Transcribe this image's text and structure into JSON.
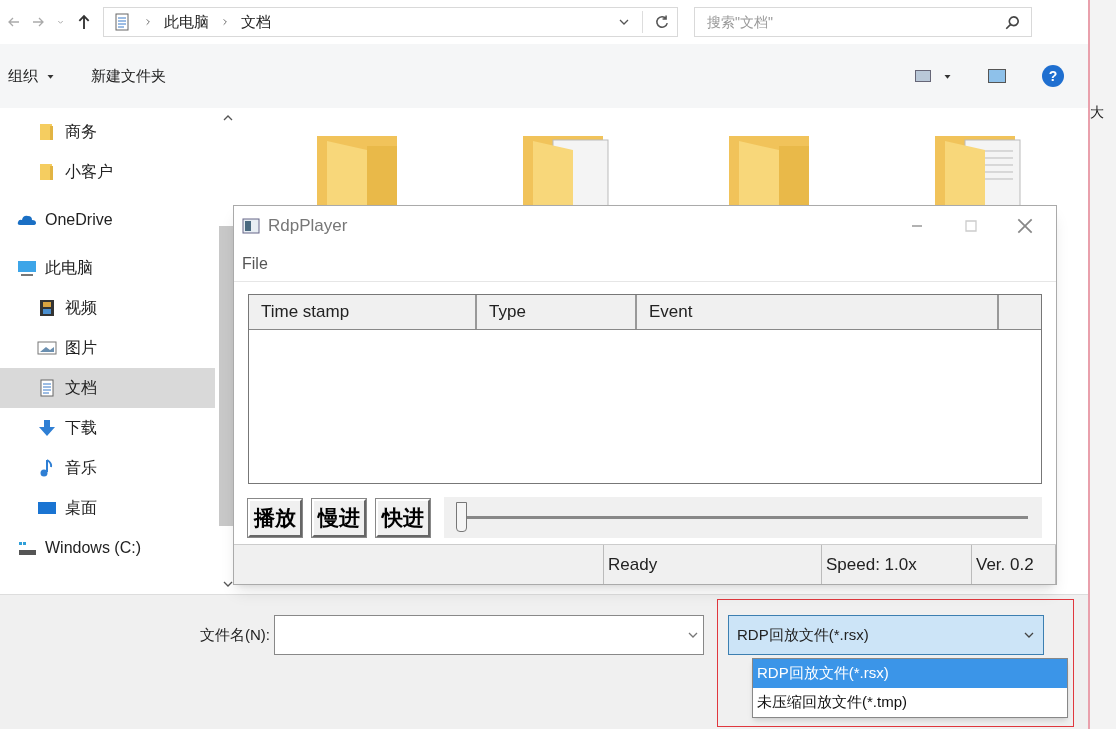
{
  "address": {
    "breadcrumb": [
      "此电脑",
      "文档"
    ],
    "search": {
      "placeholder": "搜索\"文档\""
    }
  },
  "toolbar": {
    "organize": "组织",
    "new_folder": "新建文件夹",
    "help": "?"
  },
  "sidebar": {
    "items": [
      {
        "kind": "folder",
        "label": "商务",
        "selected": false
      },
      {
        "kind": "folder",
        "label": "小客户",
        "selected": false
      },
      {
        "kind": "cloud",
        "label": "OneDrive",
        "selected": false
      },
      {
        "kind": "pc",
        "label": "此电脑",
        "selected": false
      },
      {
        "kind": "video",
        "label": "视频",
        "selected": false
      },
      {
        "kind": "picture",
        "label": "图片",
        "selected": false
      },
      {
        "kind": "document",
        "label": "文档",
        "selected": true
      },
      {
        "kind": "download",
        "label": "下载",
        "selected": false
      },
      {
        "kind": "music",
        "label": "音乐",
        "selected": false
      },
      {
        "kind": "desktop",
        "label": "桌面",
        "selected": false
      },
      {
        "kind": "drive",
        "label": "Windows (C:)",
        "selected": false
      }
    ]
  },
  "content": {
    "items": [
      {
        "kind": "folder"
      },
      {
        "kind": "file_folder"
      },
      {
        "kind": "folder"
      },
      {
        "kind": "doc_folder"
      }
    ]
  },
  "player": {
    "title": "RdpPlayer",
    "menu": [
      "File"
    ],
    "columns": [
      "Time stamp",
      "Type",
      "Event"
    ],
    "buttons": [
      "播放",
      "慢进",
      "快进"
    ],
    "slider": {
      "level": 0
    },
    "status": [
      "Ready",
      "Speed: 1.0x",
      "Ver. 0.2"
    ]
  },
  "footer": {
    "filename_label": "文件名(N):",
    "filter": {
      "value": "RDP回放文件(*.rsx)",
      "expanded": true,
      "options": [
        {
          "label": "RDP回放文件(*.rsx)",
          "selected": true
        },
        {
          "label": "未压缩回放文件(*.tmp)",
          "selected": false
        }
      ]
    }
  },
  "edge_text": "大"
}
